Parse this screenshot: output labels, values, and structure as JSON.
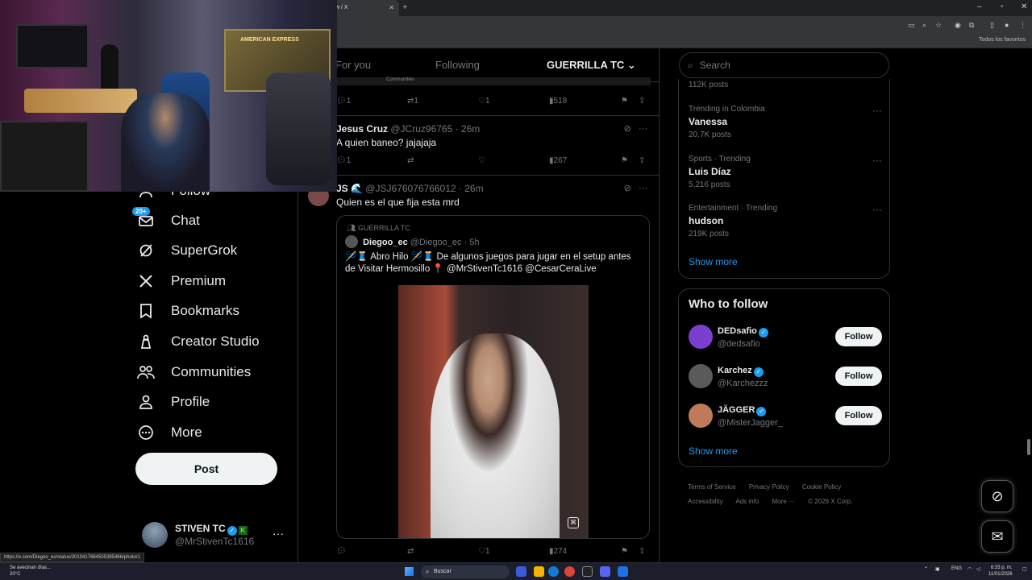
{
  "browser": {
    "tab_title": "w / X",
    "bookmarks_label": "Todos los favoritos"
  },
  "sidebar": {
    "items": [
      {
        "label": "Follow",
        "icon": "person-add-icon"
      },
      {
        "label": "Chat",
        "icon": "envelope-icon",
        "badge": "20+"
      },
      {
        "label": "SuperGrok",
        "icon": "grok-icon"
      },
      {
        "label": "Premium",
        "icon": "x-logo-icon"
      },
      {
        "label": "Bookmarks",
        "icon": "bookmark-icon"
      },
      {
        "label": "Creator Studio",
        "icon": "creator-studio-icon"
      },
      {
        "label": "Communities",
        "icon": "communities-icon"
      },
      {
        "label": "Profile",
        "icon": "person-icon"
      },
      {
        "label": "More",
        "icon": "more-circle-icon"
      }
    ],
    "post_label": "Post",
    "account": {
      "name": "STIVEN TC",
      "handle": "@MrStivenTc1616",
      "k": "K"
    }
  },
  "timeline": {
    "tabs": [
      "For you",
      "Following",
      "GUERRILLA TC"
    ],
    "active_tab": "GUERRILLA TC",
    "top_post_community": "Communities",
    "top_post_actions": {
      "replies": "1",
      "reposts": "1",
      "likes": "1",
      "views": "518"
    },
    "posts": [
      {
        "name": "Jesus Cruz",
        "handle": "@JCruz96765",
        "time": "· 26m",
        "text": "A quien baneo? jajajaja",
        "actions": {
          "replies": "1",
          "reposts": "",
          "likes": "",
          "views": "267"
        }
      },
      {
        "name": "JS 🌊",
        "handle": "@JSJ676076766012",
        "time": "· 26m",
        "text": "Quien es el que fija esta mrd",
        "quote": {
          "community": "GUERRILLA TC",
          "name": "Diegoo_ec",
          "handle": "@Diegoo_ec",
          "time": "· 5h",
          "text": "🪡🧵 Abro Hilo 🪡🧵 De algunos juegos para jugar en el setup antes de Visitar Hermosillo 📍 @MrStivenTc1616 @CesarCeraLive"
        },
        "actions": {
          "replies": "",
          "reposts": "",
          "likes": "1",
          "views": "274"
        }
      }
    ]
  },
  "right": {
    "search_placeholder": "Search",
    "first_trend_count": "112K posts",
    "trends": [
      {
        "category": "Trending in Colombia",
        "name": "Vanessa",
        "count": "20.7K posts"
      },
      {
        "category": "Sports · Trending",
        "name": "Luis Díaz",
        "count": "5,216 posts"
      },
      {
        "category": "Entertainment · Trending",
        "name": "hudson",
        "count": "219K posts"
      }
    ],
    "show_more": "Show more",
    "who_to_follow": {
      "title": "Who to follow",
      "accounts": [
        {
          "name": "DEDsafio",
          "handle": "@dedsafio",
          "button": "Follow",
          "color": "#7b3fd0"
        },
        {
          "name": "Karchez",
          "handle": "@Karchezzz",
          "button": "Follow",
          "color": "#5a5a5a"
        },
        {
          "name": "JÄGGER",
          "handle": "@MisterJagger_",
          "button": "Follow",
          "color": "#c07a5a"
        }
      ],
      "show_more": "Show more"
    },
    "footer": {
      "links": [
        "Terms of Service",
        "Privacy Policy",
        "Cookie Policy",
        "Accessibility",
        "Ads info",
        "More ···"
      ],
      "copyright": "© 2026 X Corp."
    }
  },
  "statusbar": {
    "url": "https://x.com/Diegoo_ec/status/2010417684505395466/photo/1"
  },
  "taskbar": {
    "weather_text": "Se avecinan días...",
    "temp": "20°C",
    "search_placeholder": "Buscar",
    "lang": "ENG",
    "time": "6:33 p. m.",
    "date": "11/01/2026"
  },
  "webcam": {
    "sign_text": "AMERICAN EXPRESS"
  }
}
